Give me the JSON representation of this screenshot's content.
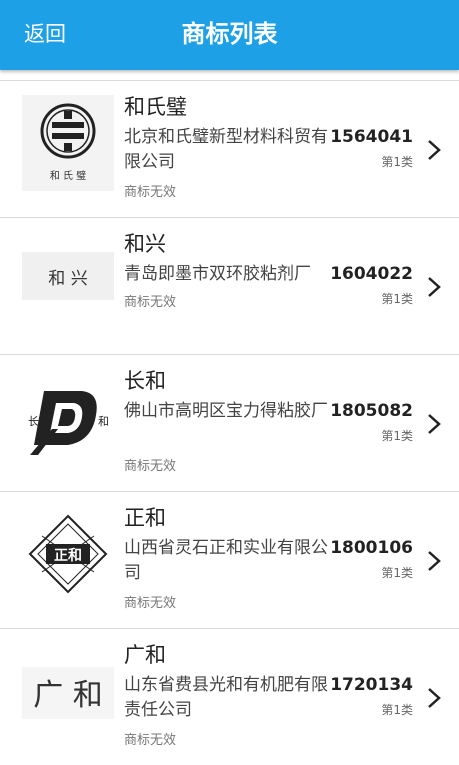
{
  "header": {
    "back_label": "返回",
    "title": "商标列表"
  },
  "colors": {
    "header_bg": "#1ea0e6",
    "header_text": "#ffffff",
    "divider": "#d9d9d9"
  },
  "trademarks": [
    {
      "name": "和氏璧",
      "company": "北京和氏璧新型材料科贸有限公司",
      "number": "1564041",
      "class": "第1类",
      "status": "商标无效",
      "logo_icon": "circle-emblem-logo",
      "logo_text": "和 氏 璧"
    },
    {
      "name": "和兴",
      "company": "青岛即墨市双环胶粘剂厂",
      "number": "1604022",
      "class": "第1类",
      "status": "商标无效",
      "logo_icon": "text-logo",
      "logo_text": "和  兴"
    },
    {
      "name": "长和",
      "company": "佛山市高明区宝力得粘胶厂",
      "number": "1805082",
      "class": "第1类",
      "status": "商标无效",
      "logo_icon": "stylized-d-logo",
      "logo_text": ""
    },
    {
      "name": "正和",
      "company": "山西省灵石正和实业有限公司",
      "number": "1800106",
      "class": "第1类",
      "status": "商标无效",
      "logo_icon": "diamond-emblem-logo",
      "logo_text": ""
    },
    {
      "name": "广和",
      "company": "山东省费县光和有机肥有限责任公司",
      "number": "1720134",
      "class": "第1类",
      "status": "商标无效",
      "logo_icon": "text-logo",
      "logo_text": "广 和"
    }
  ]
}
